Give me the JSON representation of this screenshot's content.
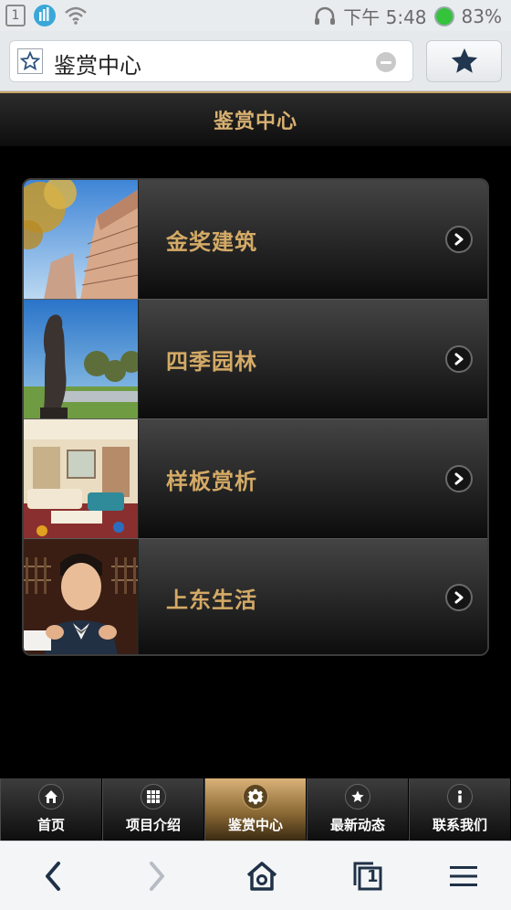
{
  "status_bar": {
    "sim_slot": "1",
    "sim_sub": "2",
    "time": "下午 5:48",
    "battery": "83%",
    "icons": [
      "sim-icon",
      "signal-icon",
      "wifi-icon",
      "headset-icon",
      "battery-icon"
    ]
  },
  "browser": {
    "url_text": "鉴赏中心",
    "icons": [
      "bookmark-outline-icon",
      "clear-icon",
      "star-icon"
    ]
  },
  "header": {
    "title": "鉴赏中心"
  },
  "menu": {
    "items": [
      {
        "label": "金奖建筑",
        "image": "building-photo"
      },
      {
        "label": "四季园林",
        "image": "garden-statue-photo"
      },
      {
        "label": "样板赏析",
        "image": "living-room-photo"
      },
      {
        "label": "上东生活",
        "image": "boy-portrait-photo"
      }
    ]
  },
  "tabs": {
    "items": [
      {
        "label": "首页",
        "icon": "home-icon"
      },
      {
        "label": "项目介绍",
        "icon": "grid-icon"
      },
      {
        "label": "鉴赏中心",
        "icon": "gear-icon",
        "active": true
      },
      {
        "label": "最新动态",
        "icon": "star-icon"
      },
      {
        "label": "联系我们",
        "icon": "info-icon"
      }
    ]
  },
  "nav": {
    "tab_count": "1",
    "icons": [
      "back-icon",
      "forward-icon",
      "home-icon",
      "tabs-icon",
      "menu-icon"
    ]
  },
  "colors": {
    "accent_gold": "#d4aa66",
    "header_bg": "#1a1a1a",
    "active_tab": "#c7a06a"
  }
}
